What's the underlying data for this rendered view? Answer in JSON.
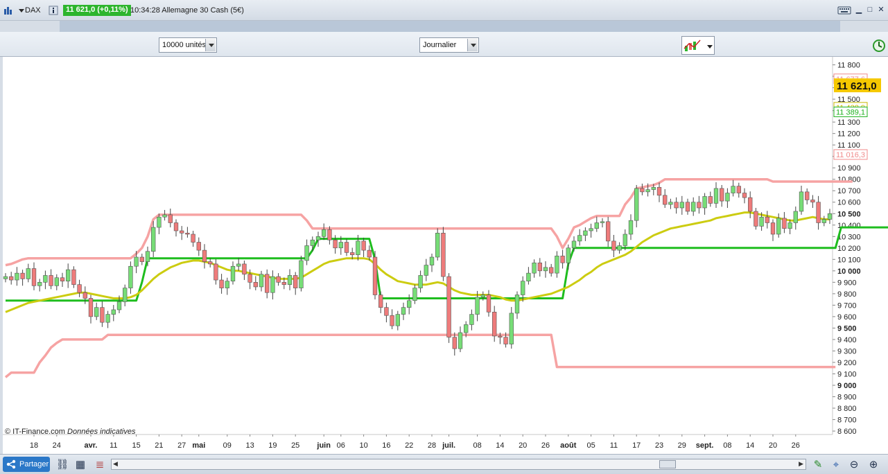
{
  "titlebar": {
    "symbol": "DAX",
    "price_change": "11 621,0 (+0,11%)",
    "time_name": "10:34:28 Allemagne 30 Cash (5€)"
  },
  "toolbar": {
    "units_select": "10000 unités",
    "period_select": "Journalier"
  },
  "chart_data": {
    "type": "candlestick",
    "y_axis_labels": [
      {
        "v": 11800,
        "t": "11 800"
      },
      {
        "v": 11700,
        "t": "11 700"
      },
      {
        "v": 11600,
        "t": "11 600"
      },
      {
        "v": 11500,
        "t": "11 500"
      },
      {
        "v": 11400,
        "t": "11 400"
      },
      {
        "v": 11300,
        "t": "11 300"
      },
      {
        "v": 11200,
        "t": "11 200"
      },
      {
        "v": 11100,
        "t": "11 100"
      },
      {
        "v": 11000,
        "t": "11 000"
      },
      {
        "v": 10900,
        "t": "10 900"
      },
      {
        "v": 10800,
        "t": "10 800"
      },
      {
        "v": 10700,
        "t": "10 700"
      },
      {
        "v": 10600,
        "t": "10 600"
      },
      {
        "v": 10500,
        "t": "10 500",
        "bold": true
      },
      {
        "v": 10400,
        "t": "10 400"
      },
      {
        "v": 10300,
        "t": "10 300"
      },
      {
        "v": 10200,
        "t": "10 200"
      },
      {
        "v": 10100,
        "t": "10 100"
      },
      {
        "v": 10000,
        "t": "10 000",
        "bold": true
      },
      {
        "v": 9900,
        "t": "9 900"
      },
      {
        "v": 9800,
        "t": "9 800"
      },
      {
        "v": 9700,
        "t": "9 700"
      },
      {
        "v": 9600,
        "t": "9 600"
      },
      {
        "v": 9500,
        "t": "9 500",
        "bold": true
      },
      {
        "v": 9400,
        "t": "9 400"
      },
      {
        "v": 9300,
        "t": "9 300"
      },
      {
        "v": 9200,
        "t": "9 200"
      },
      {
        "v": 9100,
        "t": "9 100"
      },
      {
        "v": 9000,
        "t": "9 000",
        "bold": true
      },
      {
        "v": 8900,
        "t": "8 900"
      },
      {
        "v": 8800,
        "t": "8 800"
      },
      {
        "v": 8700,
        "t": "8 700"
      },
      {
        "v": 8600,
        "t": "8 600"
      }
    ],
    "ylim": [
      8570,
      11870
    ],
    "x_ticks": [
      {
        "i": 5,
        "t": "18"
      },
      {
        "i": 9,
        "t": "24"
      },
      {
        "i": 15,
        "t": "avr.",
        "bold": true
      },
      {
        "i": 19,
        "t": "11"
      },
      {
        "i": 23,
        "t": "15"
      },
      {
        "i": 27,
        "t": "21"
      },
      {
        "i": 31,
        "t": "27"
      },
      {
        "i": 34,
        "t": "mai",
        "bold": true
      },
      {
        "i": 39,
        "t": "09"
      },
      {
        "i": 43,
        "t": "13"
      },
      {
        "i": 47,
        "t": "19"
      },
      {
        "i": 51,
        "t": "25"
      },
      {
        "i": 56,
        "t": "juin",
        "bold": true
      },
      {
        "i": 59,
        "t": "06"
      },
      {
        "i": 63,
        "t": "10"
      },
      {
        "i": 67,
        "t": "16"
      },
      {
        "i": 71,
        "t": "22"
      },
      {
        "i": 75,
        "t": "28"
      },
      {
        "i": 78,
        "t": "juil.",
        "bold": true
      },
      {
        "i": 83,
        "t": "08"
      },
      {
        "i": 87,
        "t": "14"
      },
      {
        "i": 91,
        "t": "20"
      },
      {
        "i": 95,
        "t": "26"
      },
      {
        "i": 99,
        "t": "août",
        "bold": true
      },
      {
        "i": 103,
        "t": "05"
      },
      {
        "i": 107,
        "t": "11"
      },
      {
        "i": 111,
        "t": "17"
      },
      {
        "i": 115,
        "t": "23"
      },
      {
        "i": 119,
        "t": "29"
      },
      {
        "i": 123,
        "t": "sept.",
        "bold": true
      },
      {
        "i": 127,
        "t": "08"
      },
      {
        "i": 131,
        "t": "14"
      },
      {
        "i": 135,
        "t": "20"
      },
      {
        "i": 139,
        "t": "26"
      }
    ],
    "closes": [
      9950,
      9920,
      9980,
      9930,
      10020,
      9870,
      9900,
      9960,
      9870,
      9940,
      9910,
      10010,
      9880,
      9810,
      9760,
      9600,
      9680,
      9550,
      9620,
      9660,
      9730,
      9850,
      10040,
      10120,
      10080,
      10170,
      10380,
      10470,
      10490,
      10420,
      10350,
      10330,
      10320,
      10250,
      10180,
      10080,
      10060,
      9920,
      9850,
      9910,
      10040,
      10060,
      9970,
      9900,
      9860,
      9970,
      9810,
      9950,
      9900,
      9880,
      9960,
      9850,
      10090,
      10220,
      10270,
      10300,
      10360,
      10270,
      10200,
      10250,
      10160,
      10140,
      10260,
      10180,
      10120,
      9790,
      9680,
      9610,
      9520,
      9620,
      9680,
      9740,
      9850,
      9960,
      10050,
      10120,
      10330,
      9950,
      9420,
      9320,
      9460,
      9530,
      9620,
      9770,
      9790,
      9640,
      9430,
      9420,
      9360,
      9630,
      9790,
      9910,
      9980,
      10070,
      10000,
      10030,
      9980,
      10130,
      10070,
      10200,
      10260,
      10310,
      10350,
      10370,
      10420,
      10430,
      10260,
      10180,
      10220,
      10320,
      10440,
      10720,
      10690,
      10710,
      10730,
      10660,
      10580,
      10600,
      10550,
      10600,
      10520,
      10600,
      10550,
      10650,
      10590,
      10720,
      10610,
      10680,
      10740,
      10680,
      10640,
      10520,
      10390,
      10470,
      10420,
      10320,
      10460,
      10370,
      10420,
      10520,
      10690,
      10620,
      10600,
      10420,
      10450,
      10500
    ],
    "upper_band": [
      10050,
      10060,
      10080,
      10100,
      10110,
      10110,
      10110,
      10110,
      10110,
      10110,
      10110,
      10110,
      10110,
      10110,
      10110,
      10110,
      10110,
      10110,
      10110,
      10110,
      10110,
      10110,
      10110,
      10150,
      10200,
      10300,
      10450,
      10490,
      10490,
      10490,
      10490,
      10490,
      10490,
      10490,
      10490,
      10490,
      10490,
      10490,
      10490,
      10490,
      10490,
      10490,
      10490,
      10490,
      10490,
      10490,
      10490,
      10490,
      10490,
      10490,
      10490,
      10490,
      10490,
      10440,
      10370,
      10370,
      10370,
      10370,
      10370,
      10370,
      10370,
      10370,
      10370,
      10370,
      10370,
      10370,
      10370,
      10370,
      10370,
      10370,
      10370,
      10370,
      10370,
      10370,
      10370,
      10370,
      10370,
      10370,
      10370,
      10370,
      10370,
      10370,
      10370,
      10370,
      10370,
      10370,
      10370,
      10370,
      10370,
      10370,
      10370,
      10370,
      10370,
      10370,
      10370,
      10370,
      10370,
      10300,
      10200,
      10280,
      10380,
      10400,
      10430,
      10460,
      10480,
      10480,
      10480,
      10480,
      10480,
      10580,
      10640,
      10720,
      10730,
      10740,
      10750,
      10770,
      10800,
      10800,
      10800,
      10800,
      10800,
      10800,
      10800,
      10800,
      10800,
      10800,
      10800,
      10800,
      10800,
      10800,
      10800,
      10800,
      10800,
      10800,
      10800,
      10780,
      10780,
      10780,
      10780,
      10780,
      10780,
      10780,
      10780,
      10780,
      10780,
      10780,
      10780,
      10780,
      10780,
      10780
    ],
    "lower_band": [
      9070,
      9110,
      9110,
      9110,
      9110,
      9110,
      9200,
      9260,
      9330,
      9370,
      9400,
      9400,
      9400,
      9400,
      9400,
      9400,
      9400,
      9400,
      9440,
      9440,
      9440,
      9440,
      9440,
      9440,
      9440,
      9440,
      9440,
      9440,
      9440,
      9440,
      9440,
      9440,
      9440,
      9440,
      9440,
      9440,
      9440,
      9440,
      9440,
      9440,
      9440,
      9440,
      9440,
      9440,
      9440,
      9440,
      9440,
      9440,
      9440,
      9440,
      9440,
      9440,
      9440,
      9440,
      9440,
      9440,
      9440,
      9440,
      9440,
      9440,
      9440,
      9440,
      9440,
      9440,
      9440,
      9440,
      9440,
      9440,
      9440,
      9440,
      9440,
      9440,
      9440,
      9440,
      9440,
      9440,
      9440,
      9440,
      9440,
      9440,
      9440,
      9440,
      9440,
      9440,
      9440,
      9440,
      9440,
      9440,
      9440,
      9440,
      9440,
      9440,
      9440,
      9440,
      9440,
      9440,
      9440,
      9160,
      9160,
      9160,
      9160,
      9160,
      9160,
      9160,
      9160,
      9160,
      9160,
      9160,
      9160,
      9160,
      9160,
      9160,
      9160,
      9160,
      9160,
      9160,
      9160,
      9160,
      9160,
      9160,
      9160,
      9160,
      9160,
      9160,
      9160,
      9160,
      9160,
      9160,
      9160,
      9160,
      9160,
      9160,
      9160,
      9160,
      9160,
      9160,
      9160,
      9160,
      9160,
      9160,
      9160,
      9160,
      9160,
      9160,
      9160,
      9160,
      9160
    ],
    "mid_line": [
      9740,
      9740,
      9740,
      9740,
      9740,
      9740,
      9740,
      9740,
      9740,
      9740,
      9740,
      9740,
      9740,
      9740,
      9740,
      9740,
      9740,
      9740,
      9740,
      9740,
      9740,
      9740,
      9740,
      9740,
      9900,
      10110,
      10110,
      10110,
      10110,
      10110,
      10110,
      10110,
      10110,
      10110,
      10110,
      10110,
      10110,
      10110,
      10110,
      10110,
      10110,
      10110,
      10110,
      10110,
      10110,
      10110,
      10110,
      10110,
      10110,
      10110,
      10110,
      10110,
      10110,
      10110,
      10180,
      10280,
      10280,
      10280,
      10280,
      10280,
      10280,
      10280,
      10280,
      10280,
      10280,
      10100,
      9760,
      9760,
      9760,
      9760,
      9760,
      9760,
      9760,
      9760,
      9760,
      9760,
      9760,
      9760,
      9760,
      9760,
      9760,
      9760,
      9760,
      9760,
      9760,
      9760,
      9760,
      9760,
      9760,
      9760,
      9760,
      9760,
      9760,
      9760,
      9760,
      9760,
      9760,
      9760,
      9760,
      10060,
      10200,
      10200,
      10200,
      10200,
      10200,
      10200,
      10200,
      10200,
      10200,
      10200,
      10200,
      10200,
      10200,
      10200,
      10200,
      10200,
      10200,
      10200,
      10200,
      10200,
      10200,
      10200,
      10200,
      10200,
      10200,
      10200,
      10200,
      10200,
      10200,
      10200,
      10200,
      10200,
      10200,
      10200,
      10200,
      10200,
      10200,
      10200,
      10200,
      10200,
      10200,
      10200,
      10200,
      10200,
      10200,
      10200,
      10200,
      10380,
      10380,
      10380,
      10380,
      10380,
      10380,
      10380,
      10380,
      10380,
      10380,
      10380,
      10380
    ],
    "moving_average": [
      9640,
      9660,
      9680,
      9700,
      9720,
      9730,
      9740,
      9750,
      9760,
      9770,
      9780,
      9790,
      9800,
      9810,
      9810,
      9800,
      9790,
      9780,
      9770,
      9760,
      9760,
      9760,
      9770,
      9790,
      9830,
      9880,
      9930,
      9970,
      10000,
      10030,
      10050,
      10070,
      10080,
      10090,
      10090,
      10080,
      10070,
      10050,
      10030,
      10010,
      10000,
      10000,
      9990,
      9980,
      9970,
      9960,
      9950,
      9940,
      9930,
      9930,
      9930,
      9930,
      9940,
      9970,
      10000,
      10030,
      10060,
      10080,
      10090,
      10100,
      10110,
      10110,
      10110,
      10110,
      10100,
      10060,
      10010,
      9970,
      9940,
      9910,
      9900,
      9890,
      9880,
      9880,
      9880,
      9890,
      9900,
      9890,
      9860,
      9830,
      9810,
      9800,
      9790,
      9790,
      9790,
      9790,
      9780,
      9770,
      9750,
      9740,
      9740,
      9750,
      9760,
      9770,
      9780,
      9790,
      9800,
      9820,
      9840,
      9860,
      9890,
      9920,
      9960,
      9990,
      10030,
      10060,
      10080,
      10100,
      10120,
      10140,
      10170,
      10210,
      10250,
      10280,
      10310,
      10330,
      10350,
      10370,
      10380,
      10390,
      10400,
      10410,
      10420,
      10430,
      10440,
      10460,
      10470,
      10480,
      10490,
      10500,
      10510,
      10510,
      10500,
      10490,
      10480,
      10470,
      10460,
      10450,
      10440,
      10440,
      10450,
      10460,
      10470,
      10460,
      10450,
      10450
    ],
    "price_markers": [
      {
        "v": 11677.6,
        "t": "11 677,6",
        "color": "#f08a8a",
        "style": "outline"
      },
      {
        "v": 11621.0,
        "t": "11 621,0",
        "color": "#f5c800",
        "style": "current"
      },
      {
        "v": 11428.9,
        "t": "11 428,9",
        "color": "#c8b800",
        "style": "outline"
      },
      {
        "v": 11389.1,
        "t": "11 389,1",
        "color": "#1db11d",
        "style": "outline"
      },
      {
        "v": 11016.3,
        "t": "11 016,3",
        "color": "#f08a8a",
        "style": "outline"
      }
    ],
    "colors": {
      "up": "#77dd77",
      "down": "#ee7b7b",
      "band": "#f6a3a3",
      "mid": "#1ebd1e",
      "ma": "#cccc11"
    },
    "watermark": "© IT-Finance.com",
    "watermark_note": "Données indicatives"
  },
  "bottombar": {
    "share_label": "Partager"
  }
}
